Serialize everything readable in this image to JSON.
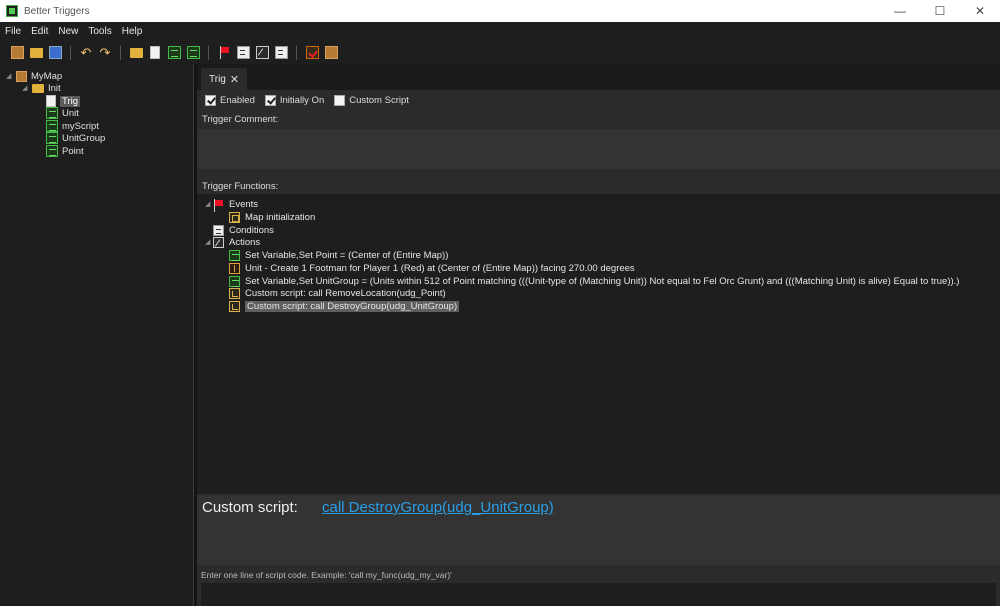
{
  "window": {
    "title": "Better Triggers",
    "controls": [
      "—",
      "☐",
      "✕"
    ]
  },
  "menu": [
    "File",
    "Edit",
    "New",
    "Tools",
    "Help"
  ],
  "toolbar": {
    "icons": [
      "map-icon",
      "open-icon",
      "save-icon",
      "undo-icon",
      "redo-icon",
      "new-folder-icon",
      "new-trigger-icon",
      "new-script-icon",
      "new-variable-icon",
      "new-event-icon",
      "new-condition-icon",
      "new-action-icon",
      "new-comment-icon",
      "test-map-icon",
      "build-map-icon"
    ]
  },
  "tree": {
    "root": "MyMap",
    "folder": "Init",
    "items": [
      {
        "label": "Trig",
        "icon": "trigger-icon",
        "selected": true
      },
      {
        "label": "Unit",
        "icon": "variable-icon"
      },
      {
        "label": "myScript",
        "icon": "script-icon"
      },
      {
        "label": "UnitGroup",
        "icon": "variable-icon"
      },
      {
        "label": "Point",
        "icon": "variable-icon"
      }
    ]
  },
  "tab": {
    "label": "Trig",
    "close": "✕"
  },
  "options": {
    "enabled": "Enabled",
    "initially_on": "Initially On",
    "custom_script": "Custom Script"
  },
  "labels": {
    "trigger_comment": "Trigger Comment:",
    "trigger_functions": "Trigger Functions:"
  },
  "functions": {
    "events": {
      "label": "Events",
      "items": [
        "Map initialization"
      ]
    },
    "conditions": {
      "label": "Conditions"
    },
    "actions": {
      "label": "Actions",
      "items": [
        "Set Variable,Set Point = (Center of (Entire Map))",
        "Unit - Create 1 Footman for Player 1 (Red) at (Center of (Entire Map)) facing 270.00 degrees",
        "Set Variable,Set UnitGroup = (Units within 512 of Point matching (((Unit-type of (Matching Unit)) Not equal to Fel Orc Grunt) and (((Matching Unit) is alive) Equal to true)).)",
        "Custom script:   call RemoveLocation(udg_Point)",
        "Custom script:   call DestroyGroup(udg_UnitGroup)"
      ]
    }
  },
  "param": {
    "label": "Custom script:",
    "value": "call DestroyGroup(udg_UnitGroup)"
  },
  "hint": "Enter one line of script code.  Example: 'call my_func(udg_my_var)'",
  "script_input": {
    "value": "",
    "placeholder": ""
  }
}
